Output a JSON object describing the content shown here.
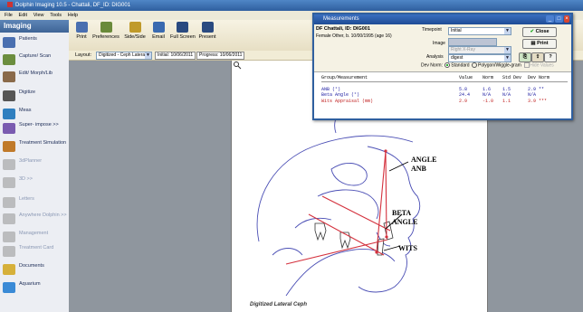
{
  "app": {
    "title": "Dolphin Imaging 10.5 - Chattali, DF_ID: DIG001",
    "menu": [
      "File",
      "Edit",
      "View",
      "Tools",
      "Help"
    ]
  },
  "sidebar": {
    "header": "Imaging",
    "items": [
      {
        "label": "Patients",
        "icon": "patients-icon",
        "color": "#4a6fb0",
        "dim": false
      },
      {
        "label": "Capture/ Scan",
        "icon": "capture-scan-icon",
        "color": "#6b8d3e",
        "dim": false
      },
      {
        "label": "Edit/ Morph/Lib",
        "icon": "edit-morph-icon",
        "color": "#8a6a4a",
        "dim": false
      },
      {
        "label": "Digitize",
        "icon": "digitize-icon",
        "color": "#555555",
        "dim": false
      },
      {
        "label": "Meas",
        "icon": "measure-icon",
        "color": "#2f7fbf",
        "dim": false
      },
      {
        "label": "Super- impose >>",
        "icon": "superimpose-icon",
        "color": "#7a5bb0",
        "dim": false
      },
      {
        "label": "Treatment Simulation",
        "icon": "treatment-simulation-icon",
        "color": "#c07a2a",
        "dim": false
      },
      {
        "label": "3dPlanner",
        "icon": "planner-3d-icon",
        "color": "#8a8a8a",
        "dim": true
      },
      {
        "label": "3D >>",
        "icon": "3d-icon",
        "color": "#8a8a8a",
        "dim": true
      },
      {
        "label": "Letters",
        "icon": "letters-icon",
        "color": "#8a8a8a",
        "dim": true
      },
      {
        "label": "Anywhere Dolphin >>",
        "icon": "anywhere-dolphin-icon",
        "color": "#8a8a8a",
        "dim": true
      },
      {
        "label": "Management",
        "icon": "management-icon",
        "color": "#8a8a8a",
        "dim": true
      },
      {
        "label": "Treatment Card",
        "icon": "treatment-card-icon",
        "color": "#8a8a8a",
        "dim": true
      },
      {
        "label": "Documents",
        "icon": "documents-icon",
        "color": "#d6b03a",
        "dim": false
      },
      {
        "label": "Aquarium",
        "icon": "aquarium-icon",
        "color": "#3a8ad6",
        "dim": false
      }
    ]
  },
  "toolbar": {
    "buttons": [
      {
        "label": "Print",
        "icon": "print-icon",
        "color": "#4a6fb0"
      },
      {
        "label": "Preferences",
        "icon": "preferences-icon",
        "color": "#6a8a3a"
      },
      {
        "label": "Side/Side",
        "icon": "side-by-side-icon",
        "color": "#c09a2a"
      },
      {
        "label": "Email",
        "icon": "email-icon",
        "color": "#3a6ab0"
      },
      {
        "label": "Full Screen",
        "icon": "full-screen-icon",
        "color": "#2a4a80"
      },
      {
        "label": "Present",
        "icon": "present-icon",
        "color": "#2a4a80"
      }
    ],
    "layout_label": "Layout:",
    "layout_value": "Digitized - Ceph Lateral",
    "initial_tab": "Initial: 10/06/2011",
    "progress_tab": "Progress: 10/06/2011"
  },
  "canvas": {
    "caption": "Digitized Lateral Ceph",
    "annotations": [
      {
        "text": "ANGLE"
      },
      {
        "text": "ANB"
      },
      {
        "text": "BETA"
      },
      {
        "text": "ANGLE"
      },
      {
        "text": "WITS"
      }
    ]
  },
  "measurements": {
    "title": "Measurements",
    "patient_id": "DF Chattali, ID: DIG001",
    "patient_info": "Female Other, b. 10/00/1995 (age 16)",
    "timepoint_label": "Timepoint",
    "timepoint_value": "Initial",
    "image_label": "Image",
    "image_value": "Right X-Ray",
    "analysis_label": "Analysis",
    "analysis_value": "digest",
    "dev_norm_label": "Dev Norm:",
    "radio_standard": "Standard",
    "radio_polygon": "Polygon/Wiggle-gram",
    "hide_values": "Hide Values",
    "close_label": "Close",
    "print_label": "Print",
    "table_headers": [
      "Group/Measurement",
      "Value",
      "Norm",
      "Std Dev",
      "Dev Norm"
    ],
    "rows": [
      {
        "name": "ANB (°)",
        "value": "5.8",
        "norm": "1.6",
        "std": "1.5",
        "dev": "2.9 **",
        "color": "#1a1aa0"
      },
      {
        "name": "Beta Angle (°)",
        "value": "24.4",
        "norm": "N/A",
        "std": "N/A",
        "dev": "N/A",
        "color": "#1a1aa0"
      },
      {
        "name": "Wits Appraisal (mm)",
        "value": "2.9",
        "norm": "-1.0",
        "std": "1.1",
        "dev": "3.9 ***",
        "color": "#c02020"
      }
    ]
  }
}
